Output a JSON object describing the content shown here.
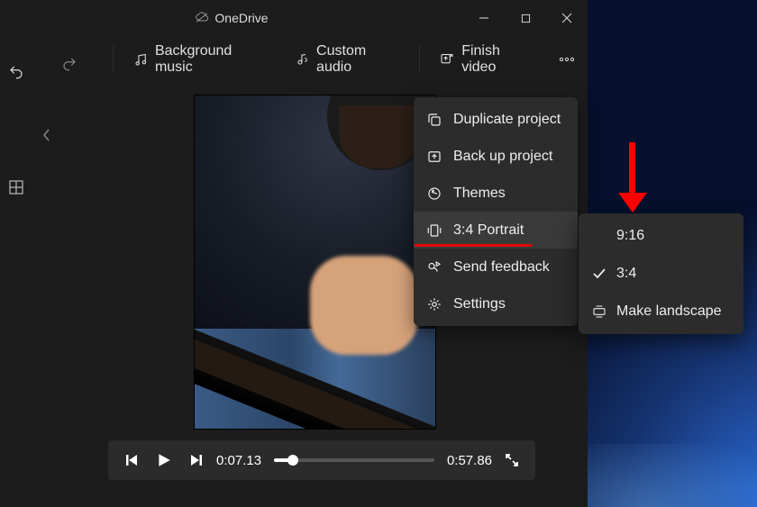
{
  "titlebar": {
    "title": "OneDrive"
  },
  "toolbar": {
    "background_music": "Background music",
    "custom_audio": "Custom audio",
    "finish_video": "Finish video"
  },
  "playback": {
    "current_time": "0:07.13",
    "total_time": "0:57.86"
  },
  "menu": {
    "duplicate": "Duplicate project",
    "backup": "Back up project",
    "themes": "Themes",
    "aspect": "3:4 Portrait",
    "feedback": "Send feedback",
    "settings": "Settings"
  },
  "submenu": {
    "opt_916": "9:16",
    "opt_34": "3:4",
    "make_landscape": "Make landscape"
  }
}
